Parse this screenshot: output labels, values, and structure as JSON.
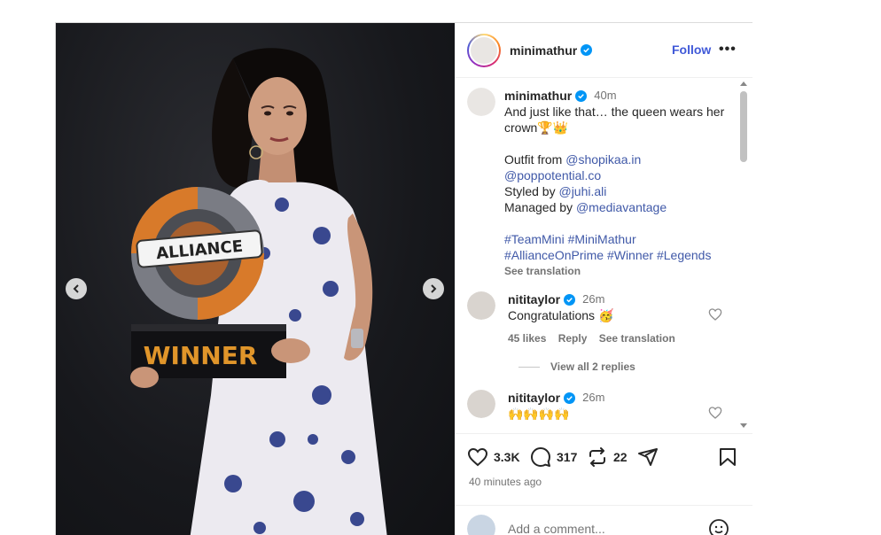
{
  "media": {
    "trophy_text_top": "ALLIANCE",
    "trophy_text_bottom": "WINNER",
    "prev_icon": "chevron-left-icon",
    "next_icon": "chevron-right-icon"
  },
  "header": {
    "username": "minimathur",
    "follow_label": "Follow",
    "more_label": "•••"
  },
  "caption": {
    "username": "minimathur",
    "time": "40m",
    "lines": [
      "And just like that… the queen wears her",
      "crown🏆👑"
    ],
    "outfit_prefix": "Outfit from ",
    "outfit_link": "@shopikaa.in",
    "outfit_link2": "@poppotential.co",
    "styled_prefix": "Styled by ",
    "styled_link": "@juhi.ali",
    "managed_prefix": "Managed by ",
    "managed_link": "@mediavantage",
    "hashtags_line1": "#TeamMini #MiniMathur",
    "hashtags_line2": "#AllianceOnPrime #Winner #Legends",
    "see_translation": "See translation"
  },
  "comments": [
    {
      "username": "nititaylor",
      "time": "26m",
      "text": "Congratulations 🥳",
      "likes": "45 likes",
      "reply": "Reply",
      "see_translation": "See translation",
      "view_replies": "View all 2 replies"
    },
    {
      "username": "nititaylor",
      "time": "26m",
      "text": "🙌🙌🙌🙌"
    }
  ],
  "actions": {
    "likes": "3.3K",
    "comments": "317",
    "reposts": "22"
  },
  "timestamp": "40 minutes ago",
  "add_comment": {
    "placeholder": "Add a comment..."
  },
  "colors": {
    "link": "#4059a8",
    "follow": "#4059d8",
    "verified": "#0095f6"
  }
}
